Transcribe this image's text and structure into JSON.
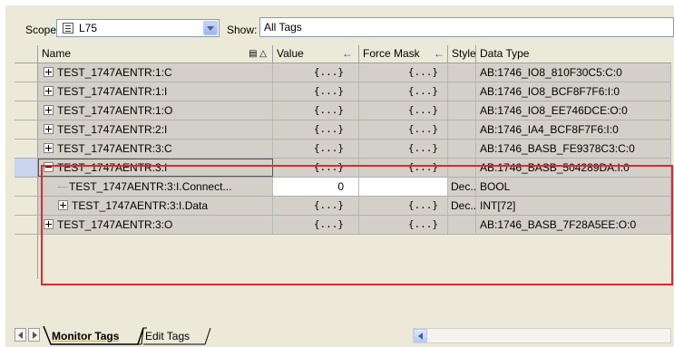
{
  "toolbar": {
    "scope_label": "Scope:",
    "scope_value": "L75",
    "show_label": "Show:",
    "show_value": "All Tags"
  },
  "grid": {
    "columns": {
      "name": "Name",
      "value": "Value",
      "force_mask": "Force Mask",
      "style": "Style",
      "data_type": "Data Type"
    },
    "rows": [
      {
        "name": "TEST_1747AENTR:1:C",
        "value": "{...}",
        "force": "{...}",
        "style": "",
        "type": "AB:1746_IO8_810F30C5:C:0"
      },
      {
        "name": "TEST_1747AENTR:1:I",
        "value": "{...}",
        "force": "{...}",
        "style": "",
        "type": "AB:1746_IO8_BCF8F7F6:I:0"
      },
      {
        "name": "TEST_1747AENTR:1:O",
        "value": "{...}",
        "force": "{...}",
        "style": "",
        "type": "AB:1746_IO8_EE746DCE:O:0"
      },
      {
        "name": "TEST_1747AENTR:2:I",
        "value": "{...}",
        "force": "{...}",
        "style": "",
        "type": "AB:1746_IA4_BCF8F7F6:I:0"
      },
      {
        "name": "TEST_1747AENTR:3:C",
        "value": "{...}",
        "force": "{...}",
        "style": "",
        "type": "AB:1746_BASB_FE9378C3:C:0"
      },
      {
        "name": "TEST_1747AENTR:3:I",
        "value": "{...}",
        "force": "{...}",
        "style": "",
        "type": "AB:1746_BASB_504289DA:I:0"
      },
      {
        "name": "TEST_1747AENTR:3:I.Connect...",
        "value": "0",
        "force": "",
        "style": "Dec...",
        "type": "BOOL"
      },
      {
        "name": "TEST_1747AENTR:3:I.Data",
        "value": "{...}",
        "force": "{...}",
        "style": "Dec...",
        "type": "INT[72]"
      },
      {
        "name": "TEST_1747AENTR:3:O",
        "value": "{...}",
        "force": "{...}",
        "style": "",
        "type": "AB:1746_BASB_7F28A5EE:O:0"
      }
    ]
  },
  "tabs": {
    "monitor": "Monitor Tags",
    "edit": "Edit Tags"
  },
  "colors": {
    "highlight_box": "#e8242e",
    "grid_bg": "#d4d0c8",
    "toolbar_bg": "#ece9d8"
  }
}
